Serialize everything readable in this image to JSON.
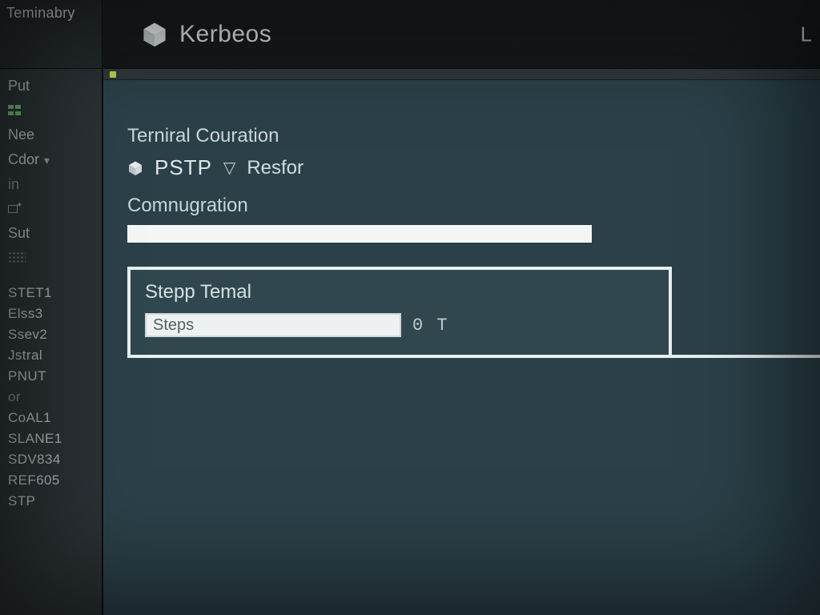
{
  "corner": {
    "label": "Teminabry"
  },
  "header": {
    "brand": "Kerbeos",
    "right": "L"
  },
  "sidebar": {
    "top": [
      {
        "label": "Put",
        "icon": ""
      },
      {
        "label": "",
        "icon": "grid"
      },
      {
        "label": "Nee",
        "icon": ""
      },
      {
        "label": "Cdor",
        "icon": "",
        "dropdown": true
      },
      {
        "label": "in",
        "icon": ""
      },
      {
        "label": "",
        "icon": "tool"
      },
      {
        "label": "Sut",
        "icon": ""
      },
      {
        "label": "",
        "icon": "dots"
      }
    ],
    "steps": [
      "STET1",
      "Elss3",
      "Ssev2",
      "Jstral",
      "PNUT",
      "or",
      "CoAL1",
      "SLANE1",
      "SDV834",
      "REF605",
      "STP"
    ]
  },
  "main": {
    "section_title": "Terniral Couration",
    "protocol_a": "PSTP",
    "protocol_b": "Resfor",
    "config_label": "Comnugration",
    "config_value": "",
    "step_box_title": "Stepp Temal",
    "step_input_value": "Steps",
    "step_readout": "0 T"
  }
}
